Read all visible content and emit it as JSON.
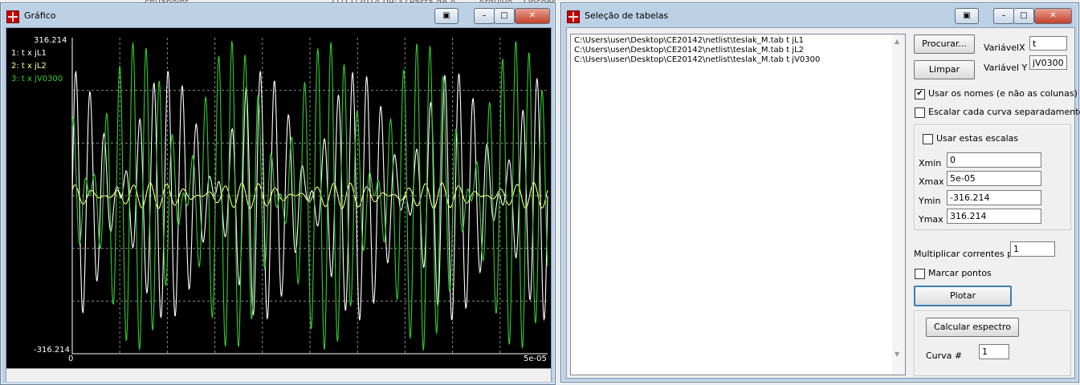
{
  "background": {
    "items": [
      "21/11/2014 09:37",
      "Pasta de A",
      "Arquivo",
      "Opções",
      "Ajuda",
      "chuapoint",
      "chuapoint.tab"
    ]
  },
  "grafico_window": {
    "title": "Gráfico",
    "controls": [
      "▣",
      "–",
      "□",
      "✕"
    ],
    "plot": {
      "y_max_label": "316.214",
      "y_min_label": "-316.214",
      "x_min_label": "0",
      "x_max_label": "5e-05",
      "legend": [
        {
          "label": "1: t x jL1",
          "color": "#ffffff"
        },
        {
          "label": "2: t x jL2",
          "color": "#ffff99"
        },
        {
          "label": "3: t x jV0300",
          "color": "#33cc33"
        }
      ]
    }
  },
  "chart_data": {
    "type": "line",
    "xlim": [
      0,
      5e-05
    ],
    "ylim": [
      -316.214,
      316.214
    ],
    "grid": true,
    "legend_position": "top-left",
    "series": [
      {
        "name": "1: t x jL1",
        "color": "#ffffff",
        "f1": 31,
        "f2": 36,
        "amplitude": 250
      },
      {
        "name": "2: t x jL2",
        "color": "#ffff88",
        "f1": 26,
        "f2": 31,
        "amplitude": 26
      },
      {
        "name": "3: t x jV0300",
        "color": "#33cc33",
        "f1": 33.5,
        "f2": 38.5,
        "amplitude": 310
      }
    ]
  },
  "selecao_window": {
    "title": "Seleção de tabelas",
    "controls": [
      "▣",
      "–",
      "□",
      "✕"
    ],
    "files": [
      "C:\\Users\\user\\Desktop\\CE20142\\netlist\\teslak_M.tab t jL1",
      "C:\\Users\\user\\Desktop\\CE20142\\netlist\\teslak_M.tab t jL2",
      "C:\\Users\\user\\Desktop\\CE20142\\netlist\\teslak_M.tab t jV0300"
    ],
    "buttons": {
      "procurar": "Procurar...",
      "limpar": "Limpar",
      "plotar": "Plotar",
      "calcular": "Calcular espectro"
    },
    "variavel_x_label": "VariávelX",
    "variavel_x_value": "t",
    "variavel_y_label": "Variável Y",
    "variavel_y_value": "jV0300",
    "usar_nomes": {
      "label": "Usar os nomes (e não as colunas)",
      "checked": true
    },
    "escalar": {
      "label": "Escalar cada curva separadamente",
      "checked": false
    },
    "usar_escalas": {
      "label": "Usar estas escalas",
      "checked": false
    },
    "xmin_label": "Xmin",
    "xmin_value": "0",
    "xmax_label": "Xmax",
    "xmax_value": "5e-05",
    "ymin_label": "Ymin",
    "ymin_value": "-316.214",
    "ymax_label": "Ymax",
    "ymax_value": "316.214",
    "multiplicar_label": "Multiplicar correntes por",
    "multiplicar_value": "1",
    "marcar": {
      "label": "Marcar pontos",
      "checked": false
    },
    "curva_label": "Curva #",
    "curva_value": "1"
  }
}
